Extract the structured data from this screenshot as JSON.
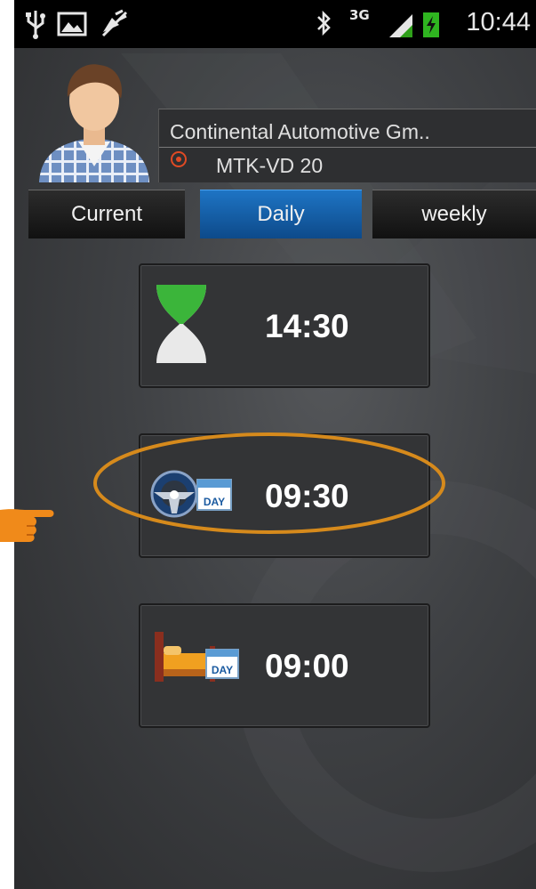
{
  "statusbar": {
    "time": "10:44",
    "network": "3G",
    "icons": [
      "usb-icon",
      "image-icon",
      "satellite-off-icon",
      "bluetooth-icon",
      "signal-icon",
      "battery-charging-icon"
    ]
  },
  "profile": {
    "company": "Continental Automotive Gm..",
    "device": "MTK-VD 20"
  },
  "tabs": [
    {
      "label": "Current",
      "active": false
    },
    {
      "label": "Daily",
      "active": true
    },
    {
      "label": "weekly",
      "active": false
    }
  ],
  "cards": [
    {
      "icon": "hourglass-icon",
      "value": "14:30"
    },
    {
      "icon": "steering-wheel-day-icon",
      "value": "09:30"
    },
    {
      "icon": "bed-day-icon",
      "value": "09:00"
    }
  ],
  "colors": {
    "accent_tab": "#1565b5",
    "highlight_ring": "#d68a1c",
    "pointer": "#f08a1a"
  }
}
